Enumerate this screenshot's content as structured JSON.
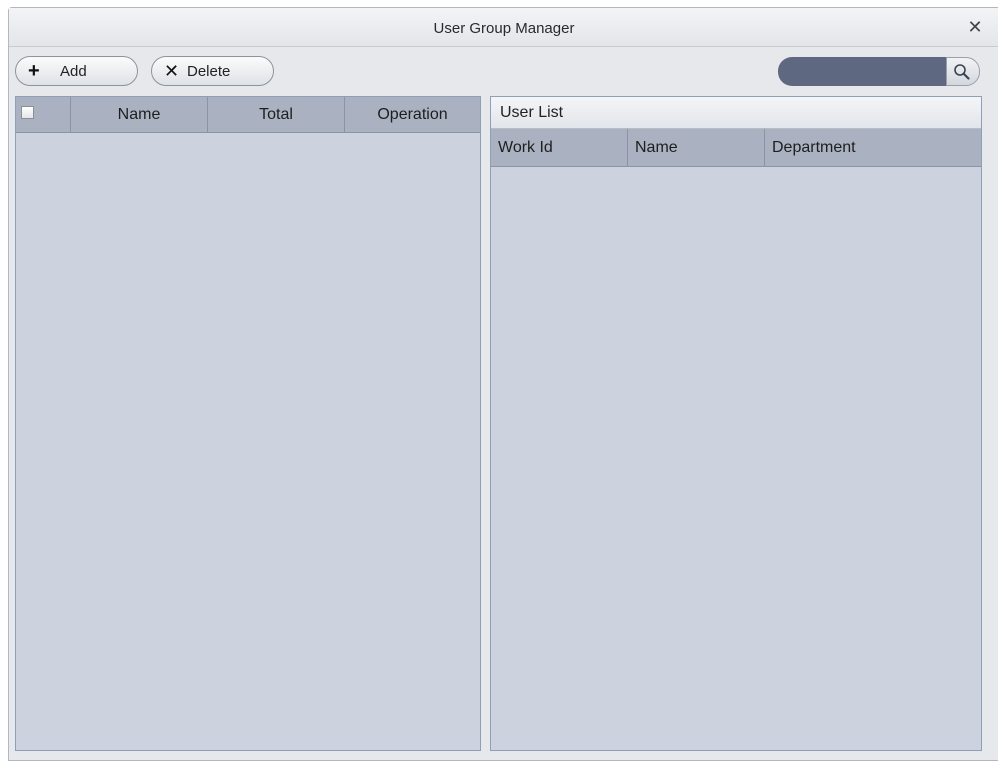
{
  "window": {
    "title": "User Group Manager",
    "close_glyph": "✕"
  },
  "toolbar": {
    "add_icon": "+",
    "add_label": "Add",
    "delete_icon": "✕",
    "delete_label": "Delete",
    "search_value": "",
    "search_icon": "search-icon"
  },
  "group_table": {
    "columns": [
      "",
      "Name",
      "Total",
      "Operation"
    ],
    "rows": []
  },
  "user_list": {
    "title": "User List",
    "columns": [
      "Work Id",
      "Name",
      "Department"
    ],
    "rows": []
  },
  "colors": {
    "panel_bg": "#ccd3de",
    "header_bg": "#aab2c2",
    "search_bg": "#5e6880",
    "window_bg": "#e6e8ec"
  }
}
